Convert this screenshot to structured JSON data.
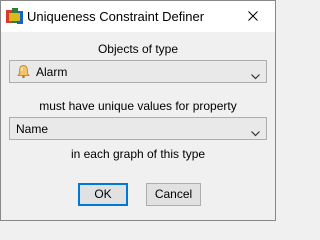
{
  "window": {
    "title": "Uniqueness Constraint Definer",
    "app_icon": "metaedit-app-icon",
    "close_icon": "close-icon"
  },
  "dialog": {
    "objects_label": "Objects of type",
    "object_type": {
      "selected": "Alarm",
      "icon": "alarm-bell-icon"
    },
    "property_label": "must have unique values for property",
    "property": {
      "selected": "Name"
    },
    "scope_label": "in each graph of this type"
  },
  "buttons": {
    "ok_label": "OK",
    "cancel_label": "Cancel"
  }
}
